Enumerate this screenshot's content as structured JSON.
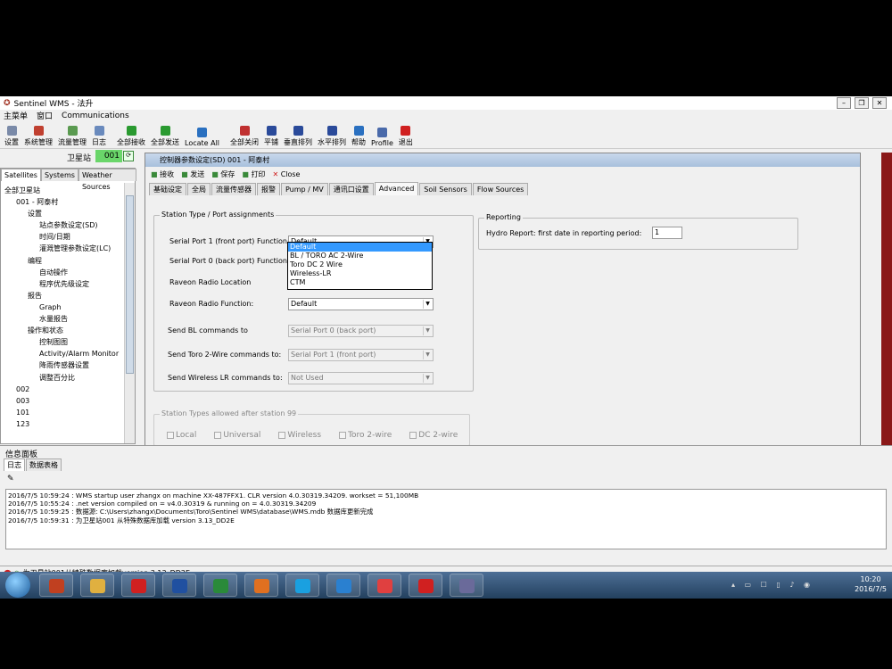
{
  "window": {
    "title": "Sentinel WMS - 法升"
  },
  "menu": [
    "主菜单",
    "窗口",
    "Communications"
  ],
  "toolbar": [
    {
      "l": "设置",
      "c": "#7a8aa8"
    },
    {
      "l": "系统管理",
      "c": "#c04030"
    },
    {
      "l": "流量管理",
      "c": "#5a9a50"
    },
    {
      "l": "日志",
      "c": "#6a8abd"
    },
    {
      "l": "全部接收",
      "c": "#2a9a30"
    },
    {
      "l": "全部发送",
      "c": "#2a9a30"
    },
    {
      "l": "Locate All",
      "c": "#2a70c0"
    },
    {
      "l": "全部关闭",
      "c": "#c03030"
    },
    {
      "l": "平铺",
      "c": "#2a4a9a"
    },
    {
      "l": "垂直排列",
      "c": "#2a4a9a"
    },
    {
      "l": "水平排列",
      "c": "#2a4a9a"
    },
    {
      "l": "帮助",
      "c": "#2a70c0"
    },
    {
      "l": "Profile",
      "c": "#4a6aaa"
    },
    {
      "l": "退出",
      "c": "#d02020"
    }
  ],
  "satellite": {
    "label": "卫星站",
    "value": "001"
  },
  "left": {
    "tabs": [
      "Satellites",
      "Systems",
      "Weather Sources"
    ],
    "tree": [
      "全部卫星站",
      "001 - 阿泰村",
      "设置",
      "站点参数设定(SD)",
      "时间/日期",
      "灌溉管理参数设定(LC)",
      "编程",
      "自动操作",
      "程序优先级设定",
      "报告",
      "Graph",
      "水量报告",
      "操作和状态",
      "控制图图",
      "Activity/Alarm Monitor",
      "降雨传感器设置",
      "调整百分比",
      "002",
      "003",
      "101",
      "123"
    ]
  },
  "child": {
    "title": "控制器参数设定(SD) 001 - 阿泰村",
    "tools": [
      "接收",
      "发送",
      "保存",
      "打印",
      "Close"
    ],
    "tabs": [
      "基础设定",
      "全局",
      "流量传感器",
      "报警",
      "Pump / MV",
      "通讯口设置",
      "Advanced",
      "Soil Sensors",
      "Flow Sources"
    ],
    "g1": "Station Type / Port assignments",
    "rows": [
      {
        "l": "Serial Port 1 (front port) Function:",
        "v": "Default"
      },
      {
        "l": "Serial Port 0 (back port) Function:",
        "v": ""
      },
      {
        "l": "Raveon Radio Location",
        "v": ""
      },
      {
        "l": "Raveon Radio Function:",
        "v": "Default"
      },
      {
        "l": "Send BL commands to",
        "v": "Serial Port 0 (back port)"
      },
      {
        "l": "Send Toro 2-Wire commands to:",
        "v": "Serial Port 1 (front port)"
      },
      {
        "l": "Send Wireless LR commands to:",
        "v": "Not Used"
      }
    ],
    "dd": [
      "Default",
      "BL / TORO AC 2-Wire",
      "Toro DC 2 Wire",
      "Wireless-LR",
      "CTM"
    ],
    "g2": "Reporting",
    "rep": {
      "l": "Hydro Report: first date in reporting period:",
      "v": "1"
    },
    "g3": "Station Types allowed after station 99",
    "checks": [
      "Local",
      "Universal",
      "Wireless",
      "Toro 2-wire",
      "DC 2-wire"
    ]
  },
  "info": {
    "title": "信息面板",
    "tabs": [
      "日志",
      "数据表格"
    ],
    "log": [
      "2016/7/5 10:59:24 : WMS startup user zhangx on machine XX-487FFX1. CLR version 4.0.30319.34209. workset = 51,100MB",
      "2016/7/5 10:55:24 : .net version compiled on = v4.0.30319 & running on = 4.0.30319.34209",
      "2016/7/5 10:59:25 : 数据源: C:\\Users\\zhangx\\Documents\\Toro\\Sentinel WMS\\database\\WMS.mdb 数据库更新完成",
      "2016/7/5 10:59:31 : 为卫星站001    从特殊数据库加载 version 3.13_DD2E"
    ]
  },
  "status": {
    "text": "为卫星站001从特殊数据库加载version 3.13_DD2E"
  },
  "clock": {
    "time": "10:20",
    "date": "2016/7/5"
  }
}
